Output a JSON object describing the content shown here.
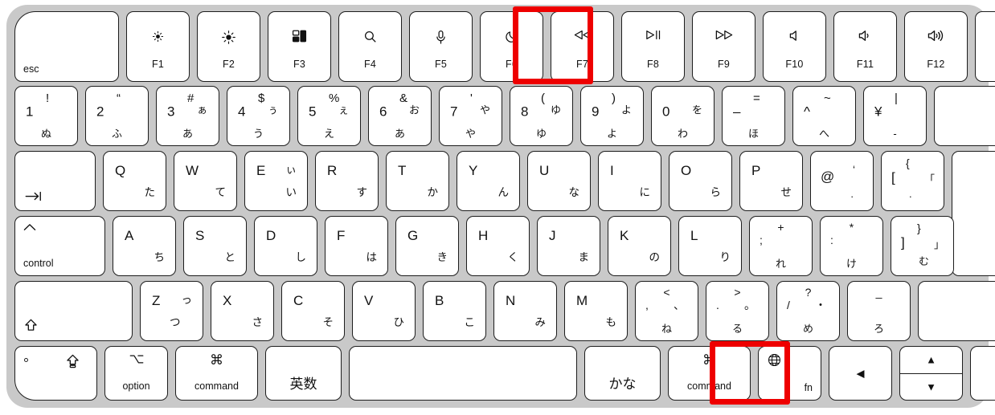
{
  "device": {
    "name": "Apple Magic Keyboard (JIS / Japanese layout)",
    "frame_color": "#c9c9c9",
    "key_color": "#ffffff",
    "highlight_color": "#ee0000"
  },
  "highlights": [
    {
      "key": "F7",
      "label": "F7",
      "note": "rewind / previous track key outlined in red"
    },
    {
      "key": "fn",
      "label": "fn",
      "note": "function / globe key outlined in red"
    }
  ],
  "rows": {
    "function_row": [
      {
        "name": "esc",
        "label": "esc"
      },
      {
        "name": "f1",
        "icon": "brightness-down-icon",
        "fn": "F1"
      },
      {
        "name": "f2",
        "icon": "brightness-up-icon",
        "fn": "F2"
      },
      {
        "name": "f3",
        "icon": "mission-control-icon",
        "fn": "F3"
      },
      {
        "name": "f4",
        "icon": "spotlight-search-icon",
        "fn": "F4"
      },
      {
        "name": "f5",
        "icon": "dictation-mic-icon",
        "fn": "F5"
      },
      {
        "name": "f6",
        "icon": "do-not-disturb-moon-icon",
        "fn": "F6"
      },
      {
        "name": "f7",
        "icon": "rewind-icon",
        "fn": "F7"
      },
      {
        "name": "f8",
        "icon": "play-pause-icon",
        "fn": "F8"
      },
      {
        "name": "f9",
        "icon": "fast-forward-icon",
        "fn": "F9"
      },
      {
        "name": "f10",
        "icon": "mute-icon",
        "fn": "F10"
      },
      {
        "name": "f11",
        "icon": "volume-down-icon",
        "fn": "F11"
      },
      {
        "name": "f12",
        "icon": "volume-up-icon",
        "fn": "F12"
      },
      {
        "name": "lock",
        "icon": "touch-id-lock-icon"
      }
    ],
    "number_row": [
      {
        "name": "key-1",
        "num": "1",
        "shift": "!",
        "kana_mid": "",
        "kana_bot": "ぬ"
      },
      {
        "name": "key-2",
        "num": "2",
        "shift": "“",
        "kana_mid": "",
        "kana_bot": "ふ"
      },
      {
        "name": "key-3",
        "num": "3",
        "shift": "#",
        "kana_mid": "ぁ",
        "kana_bot": "あ"
      },
      {
        "name": "key-4",
        "num": "4",
        "shift": "$",
        "kana_mid": "ぅ",
        "kana_bot": "う"
      },
      {
        "name": "key-5",
        "num": "5",
        "shift": "%",
        "kana_mid": "ぇ",
        "kana_bot": "え"
      },
      {
        "name": "key-6",
        "num": "6",
        "shift": "&",
        "kana_mid": "お",
        "kana_bot": "あ"
      },
      {
        "name": "key-7",
        "num": "7",
        "shift": "'",
        "kana_mid": "や",
        "kana_bot": "や"
      },
      {
        "name": "key-8",
        "num": "8",
        "shift": "(",
        "kana_mid": "ゆ",
        "kana_bot": "ゆ"
      },
      {
        "name": "key-9",
        "num": "9",
        "shift": ")",
        "kana_mid": "よ",
        "kana_bot": "よ"
      },
      {
        "name": "key-0",
        "num": "0",
        "shift": "",
        "kana_mid": "を",
        "kana_bot": "わ"
      },
      {
        "name": "key-minus",
        "num": "–",
        "shift": "=",
        "kana_mid": "",
        "kana_bot": "ほ"
      },
      {
        "name": "key-caret",
        "num": "^",
        "shift": "~",
        "kana_mid": "",
        "kana_bot": "へ"
      },
      {
        "name": "key-yen",
        "num": "¥",
        "shift": "|",
        "kana_mid": "",
        "kana_bot": "-"
      },
      {
        "name": "delete",
        "icon": "delete-backspace-icon"
      }
    ],
    "qwerty_row": [
      {
        "name": "tab",
        "icon": "tab-arrow-icon"
      },
      {
        "name": "key-q",
        "letter": "Q",
        "kana": "た"
      },
      {
        "name": "key-w",
        "letter": "W",
        "kana": "て"
      },
      {
        "name": "key-e",
        "letter": "E",
        "kana": "い",
        "kana_top": "ぃ"
      },
      {
        "name": "key-r",
        "letter": "R",
        "kana": "す"
      },
      {
        "name": "key-t",
        "letter": "T",
        "kana": "か"
      },
      {
        "name": "key-y",
        "letter": "Y",
        "kana": "ん"
      },
      {
        "name": "key-u",
        "letter": "U",
        "kana": "な"
      },
      {
        "name": "key-i",
        "letter": "I",
        "kana": "に"
      },
      {
        "name": "key-o",
        "letter": "O",
        "kana": "ら"
      },
      {
        "name": "key-p",
        "letter": "P",
        "kana": "せ"
      },
      {
        "name": "key-at",
        "letter": "@",
        "kana": ".",
        "kana_top": "‘"
      },
      {
        "name": "key-bracket-left",
        "letter": "[",
        "kana": ".",
        "kana_top": "{",
        "extra": "「"
      },
      {
        "name": "return",
        "icon": "return-enter-icon"
      }
    ],
    "home_row": [
      {
        "name": "control",
        "label": "control",
        "icon": "control-caret-icon"
      },
      {
        "name": "key-a",
        "letter": "A",
        "kana": "ち"
      },
      {
        "name": "key-s",
        "letter": "S",
        "kana": "と"
      },
      {
        "name": "key-d",
        "letter": "D",
        "kana": "し"
      },
      {
        "name": "key-f",
        "letter": "F",
        "kana": "は"
      },
      {
        "name": "key-g",
        "letter": "G",
        "kana": "き"
      },
      {
        "name": "key-h",
        "letter": "H",
        "kana": "く"
      },
      {
        "name": "key-j",
        "letter": "J",
        "kana": "ま"
      },
      {
        "name": "key-k",
        "letter": "K",
        "kana": "の"
      },
      {
        "name": "key-l",
        "letter": "L",
        "kana": "り"
      },
      {
        "name": "key-semicolon",
        "letter": ";",
        "shift": "+",
        "kana": "れ"
      },
      {
        "name": "key-colon",
        "letter": ":",
        "shift": "*",
        "kana": "け"
      },
      {
        "name": "key-bracket-right",
        "letter": "]",
        "shift": "}",
        "kana": "む",
        "extra": "」"
      }
    ],
    "shift_row": [
      {
        "name": "shift-left",
        "icon": "shift-arrow-icon"
      },
      {
        "name": "key-z",
        "letter": "Z",
        "kana": "つ",
        "kana_top": "っ"
      },
      {
        "name": "key-x",
        "letter": "X",
        "kana": "さ"
      },
      {
        "name": "key-c",
        "letter": "C",
        "kana": "そ"
      },
      {
        "name": "key-v",
        "letter": "V",
        "kana": "ひ"
      },
      {
        "name": "key-b",
        "letter": "B",
        "kana": "こ"
      },
      {
        "name": "key-n",
        "letter": "N",
        "kana": "み"
      },
      {
        "name": "key-m",
        "letter": "M",
        "kana": "も"
      },
      {
        "name": "key-comma",
        "letter": ",",
        "shift": "<",
        "kana": "ね",
        "kana_top": "、"
      },
      {
        "name": "key-period",
        "letter": ".",
        "shift": ">",
        "kana": "る",
        "kana_top": "。"
      },
      {
        "name": "key-slash",
        "letter": "/",
        "shift": "?",
        "kana": "め",
        "kana_top": "・"
      },
      {
        "name": "key-underscore",
        "letter": "",
        "shift": "_",
        "kana": "ろ"
      },
      {
        "name": "shift-right",
        "icon": "shift-arrow-icon"
      }
    ],
    "bottom_row": [
      {
        "name": "caps-lock",
        "icon": "caps-lock-arrow-icon",
        "led": true
      },
      {
        "name": "option-left",
        "label": "option",
        "icon": "option-alt-icon"
      },
      {
        "name": "command-left",
        "label": "command",
        "icon": "command-icon"
      },
      {
        "name": "eisu",
        "label": "英数"
      },
      {
        "name": "space",
        "label": ""
      },
      {
        "name": "kana",
        "label": "かな"
      },
      {
        "name": "command-right",
        "label": "command",
        "icon": "command-icon"
      },
      {
        "name": "fn",
        "label": "fn",
        "icon": "globe-icon"
      },
      {
        "name": "arrow-left",
        "icon": "arrow-left-icon"
      },
      {
        "name": "arrow-up-down",
        "icon_up": "arrow-up-icon",
        "icon_down": "arrow-down-icon"
      },
      {
        "name": "arrow-right",
        "icon": "arrow-right-icon"
      }
    ]
  }
}
